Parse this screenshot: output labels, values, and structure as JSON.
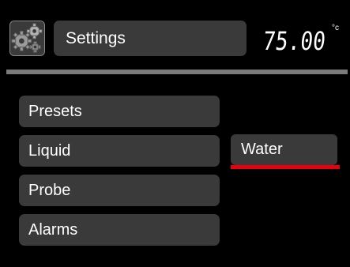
{
  "header": {
    "settings_icon": "gears-icon",
    "title": "Settings",
    "temperature": "75.00",
    "temperature_unit": "°c"
  },
  "menu": {
    "items": [
      {
        "label": "Presets"
      },
      {
        "label": "Liquid"
      },
      {
        "label": "Probe"
      },
      {
        "label": "Alarms"
      }
    ]
  },
  "liquid_value": {
    "label": "Water",
    "accent_color": "#e8000d"
  },
  "colors": {
    "background": "#000000",
    "panel": "#3a3a3a",
    "divider": "#7a7a7a",
    "text": "#ffffff"
  }
}
